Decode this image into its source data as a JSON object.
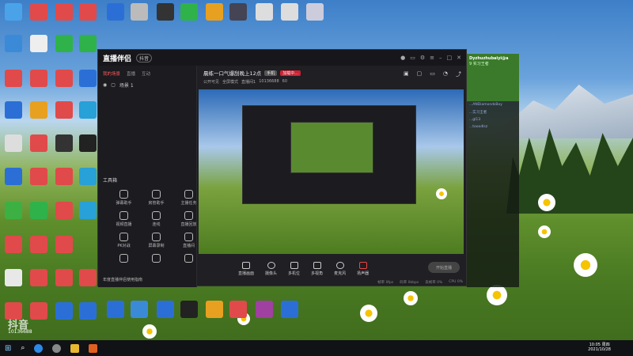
{
  "app": {
    "name": "直播伴侣",
    "name_tag": "抖音",
    "tabs": [
      "我的场景",
      "直播",
      "互动"
    ],
    "scene_label": "场景 1",
    "tools_header": "工具箱",
    "tools": [
      "弹幕助手",
      "房管助手",
      "主播任务",
      "视频直播",
      "连线",
      "直播回放",
      "PK对战",
      "屏幕录制",
      "直播间",
      "",
      "",
      ""
    ],
    "footer": "年度直播伴侣使用指南",
    "stream_title": "晨练一口气爆刮晚上12点",
    "title_badge1": "手机",
    "title_badge2": "加载中...",
    "sub_items": [
      "公开可见",
      "全屏模式",
      "直播间1",
      "10136688",
      "60"
    ],
    "controls": [
      "直播画面",
      "摄像头",
      "多机位",
      "多视角",
      "麦克风",
      "扬声器"
    ],
    "go_live": "开始直播",
    "bottom_status": [
      "帧率 0fps",
      "码率 0kbps",
      "丢帧率 0%",
      "CPU 0%"
    ]
  },
  "chat": {
    "user": "Dyzhuzhubaiyi@a",
    "sub": "9 实习王者",
    "lines": [
      "...ANDiamondsBoy",
      "...实习王者",
      "...gl13",
      "...tooodlsz"
    ]
  },
  "desktop_watermark": "抖音",
  "desktop_id": "10136688",
  "taskbar": {
    "time": "10:05 周四",
    "date": "2021/10/28"
  }
}
